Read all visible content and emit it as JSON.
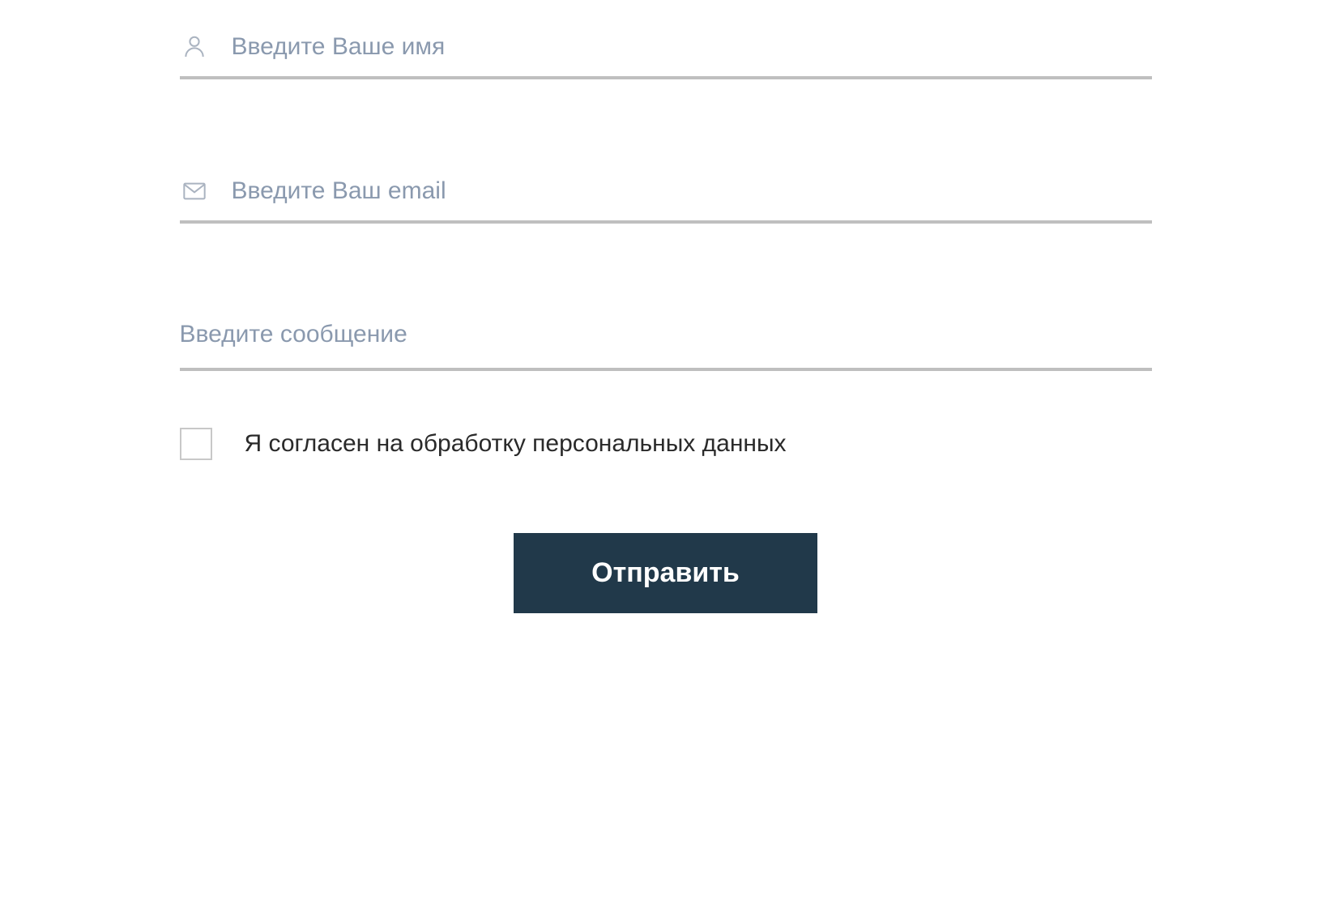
{
  "form": {
    "name": {
      "placeholder": "Введите Ваше имя",
      "value": ""
    },
    "email": {
      "placeholder": "Введите Ваш email",
      "value": ""
    },
    "message": {
      "placeholder": "Введите сообщение",
      "value": ""
    },
    "consent": {
      "label": "Я согласен на обработку персональных данных",
      "checked": false
    },
    "submit": {
      "label": "Отправить"
    }
  },
  "colors": {
    "accent": "#21394a",
    "border": "#bfbfbf",
    "placeholder": "#8a99ae",
    "iconStroke": "#aab3c0"
  }
}
